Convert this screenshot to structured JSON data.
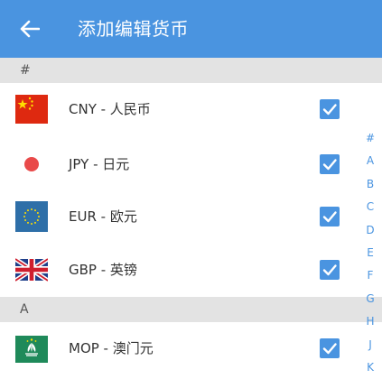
{
  "header": {
    "title": "添加编辑货币",
    "back_icon": "arrow-left-icon"
  },
  "accent_color": "#4a94e0",
  "sections": [
    {
      "label": "#",
      "items": [
        {
          "text": "CNY - 人民币",
          "checked": true,
          "flag_icon": "china-flag-icon"
        },
        {
          "text": "JPY - 日元",
          "checked": true,
          "flag_icon": "japan-flag-icon"
        },
        {
          "text": "EUR - 欧元",
          "checked": true,
          "flag_icon": "eu-flag-icon"
        },
        {
          "text": "GBP - 英镑",
          "checked": true,
          "flag_icon": "uk-flag-icon"
        }
      ]
    },
    {
      "label": "A",
      "items": [
        {
          "text": "MOP - 澳门元",
          "checked": true,
          "flag_icon": "macau-flag-icon"
        }
      ]
    }
  ],
  "index_letters": [
    "#",
    "A",
    "B",
    "C",
    "D",
    "E",
    "F",
    "G",
    "H",
    "J",
    "K"
  ]
}
